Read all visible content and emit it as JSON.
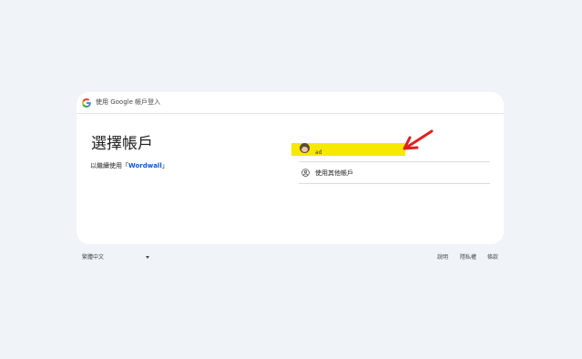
{
  "header": {
    "text": "使用 Google 帳戶登入",
    "google_colors": [
      "#4285F4",
      "#EA4335",
      "#FBBC05",
      "#34A853"
    ]
  },
  "main": {
    "title": "選擇帳戶",
    "subtitle_prefix": "以繼續使用「",
    "app_name": "Wordwall",
    "subtitle_suffix": "」",
    "accounts": [
      {
        "email": "ad",
        "avatar": "profile-photo"
      }
    ],
    "other_account_label": "使用其他帳戶",
    "other_account_icon": "person-circle-icon"
  },
  "annotation": {
    "highlight_color": "#f7e800",
    "arrow_color": "#e02020"
  },
  "footer": {
    "language": "繁體中文",
    "links": [
      "說明",
      "隱私權",
      "條款"
    ]
  }
}
